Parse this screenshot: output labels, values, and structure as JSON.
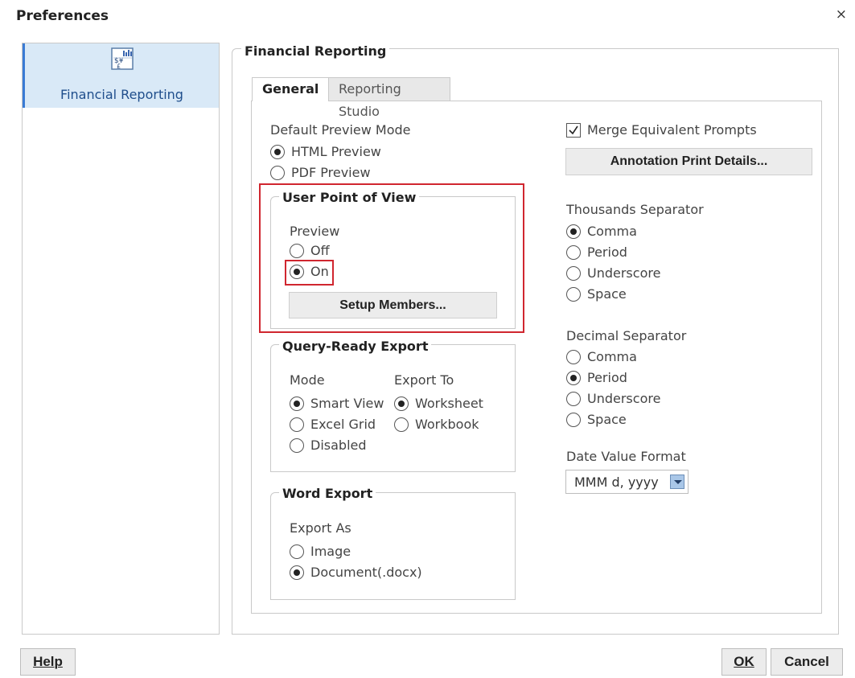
{
  "dialog": {
    "title": "Preferences",
    "close_label": "×"
  },
  "sidebar": {
    "items": [
      {
        "label": "Financial Reporting",
        "icon": "financial-reporting-icon"
      }
    ]
  },
  "panel": {
    "title": "Financial Reporting",
    "tabs": [
      {
        "label": "General",
        "active": true
      },
      {
        "label": "Reporting Studio",
        "active": false
      }
    ]
  },
  "preview_mode": {
    "label": "Default Preview Mode",
    "options": [
      {
        "label": "HTML Preview",
        "selected": true
      },
      {
        "label": "PDF Preview",
        "selected": false
      }
    ]
  },
  "user_pov": {
    "title": "User Point of View",
    "preview_label": "Preview",
    "options": [
      {
        "label": "Off",
        "selected": false
      },
      {
        "label": "On",
        "selected": true
      }
    ],
    "setup_button": "Setup Members..."
  },
  "query_export": {
    "title": "Query-Ready Export",
    "mode_label": "Mode",
    "mode_options": [
      {
        "label": "Smart View",
        "selected": true
      },
      {
        "label": "Excel Grid",
        "selected": false
      },
      {
        "label": "Disabled",
        "selected": false
      }
    ],
    "export_to_label": "Export To",
    "export_to_options": [
      {
        "label": "Worksheet",
        "selected": true
      },
      {
        "label": "Workbook",
        "selected": false
      }
    ]
  },
  "word_export": {
    "title": "Word Export",
    "export_as_label": "Export As",
    "options": [
      {
        "label": "Image",
        "selected": false
      },
      {
        "label": "Document(.docx)",
        "selected": true
      }
    ]
  },
  "right": {
    "merge_label": "Merge Equivalent Prompts",
    "merge_checked": true,
    "annotation_button": "Annotation Print Details...",
    "thousands": {
      "label": "Thousands Separator",
      "options": [
        {
          "label": "Comma",
          "selected": true
        },
        {
          "label": "Period",
          "selected": false
        },
        {
          "label": "Underscore",
          "selected": false
        },
        {
          "label": "Space",
          "selected": false
        }
      ]
    },
    "decimal": {
      "label": "Decimal Separator",
      "options": [
        {
          "label": "Comma",
          "selected": false
        },
        {
          "label": "Period",
          "selected": true
        },
        {
          "label": "Underscore",
          "selected": false
        },
        {
          "label": "Space",
          "selected": false
        }
      ]
    },
    "date_format": {
      "label": "Date Value Format",
      "value": "MMM d, yyyy"
    }
  },
  "footer": {
    "help": "Help",
    "ok": "OK",
    "cancel": "Cancel"
  },
  "colors": {
    "highlight": "#d0262f",
    "sidebar_selected": "#d9e9f7",
    "sidebar_accent": "#3a7bd5"
  }
}
